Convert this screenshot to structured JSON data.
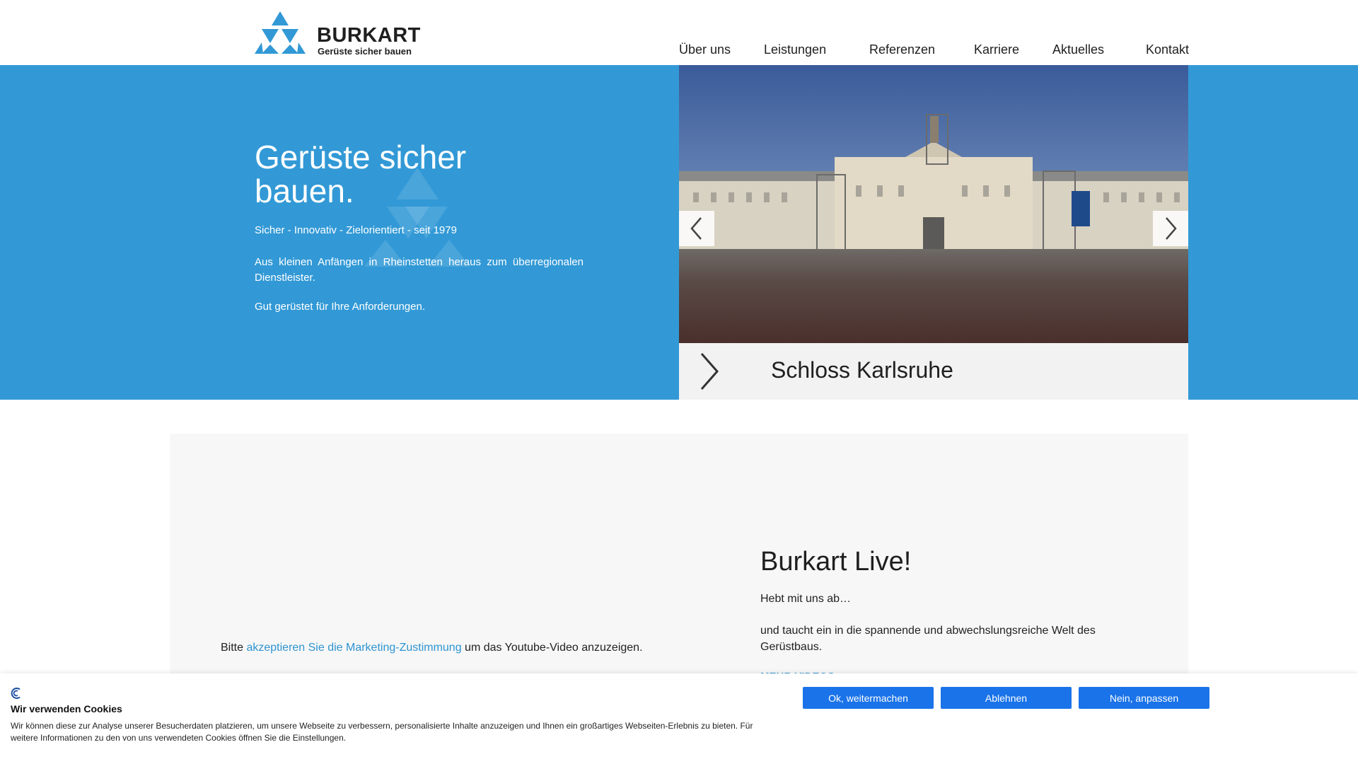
{
  "brand": {
    "name": "BURKART",
    "tagline": "Gerüste sicher bauen",
    "color": "#3299d6"
  },
  "nav": {
    "items": [
      "Über uns",
      "Leistungen",
      "Referenzen",
      "Karriere",
      "Aktuelles",
      "Kontakt"
    ]
  },
  "hero": {
    "title": "Gerüste sicher bauen.",
    "subtitle": "Sicher - Innovativ - Zielorientiert - seit 1979",
    "paragraph1": "Aus kleinen Anfängen in Rheinstetten heraus zum überregionalen Dienstleister.",
    "paragraph2": "Gut gerüstet für Ihre Anforderungen."
  },
  "slider": {
    "caption": "Schloss Karlsruhe",
    "prev_icon": "chevron-left-icon",
    "next_icon": "chevron-right-icon"
  },
  "live": {
    "video_note_prefix": "Bitte ",
    "video_note_link": "akzeptieren Sie die Marketing-Zustimmung",
    "video_note_suffix": " um das Youtube-Video anzuzeigen.",
    "title": "Burkart Live!",
    "paragraph1": "Hebt mit uns ab…",
    "paragraph2": "und taucht ein in die spannende und abwechslungsreiche Welt des Gerüstbaus.",
    "more_link": "MEHR VIDEOS"
  },
  "cookie": {
    "title": "Wir verwenden Cookies",
    "text": "Wir können diese zur Analyse unserer Besucherdaten platzieren, um unsere Webseite zu verbessern, personalisierte Inhalte anzuzeigen und Ihnen ein großartiges Webseiten-Erlebnis zu bieten. Für weitere Informationen zu den von uns verwendeten Cookies öffnen Sie die Einstellungen.",
    "accept": "Ok, weitermachen",
    "decline": "Ablehnen",
    "customize": "Nein, anpassen",
    "button_color": "#1a73e8"
  }
}
